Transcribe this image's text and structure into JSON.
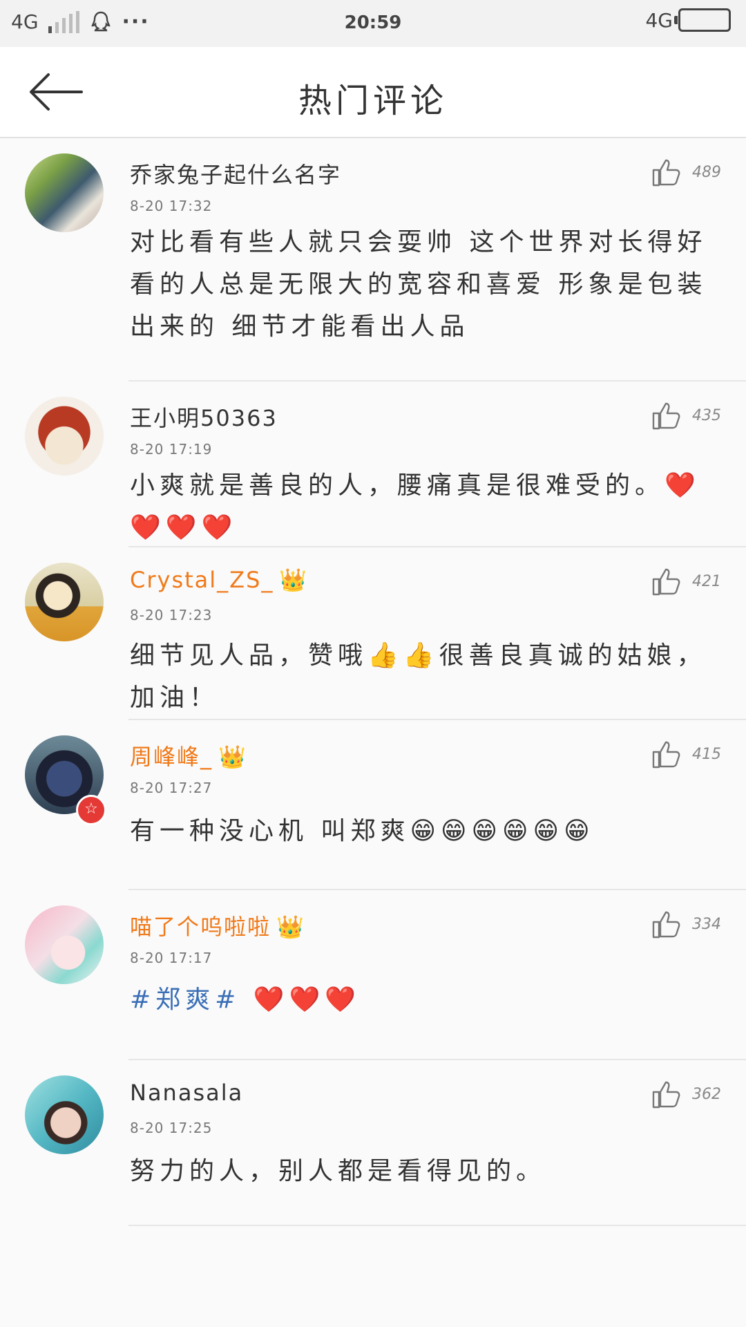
{
  "status_bar": {
    "network_left": "4G",
    "time": "20:59",
    "network_right": "4G"
  },
  "header": {
    "title": "热门评论"
  },
  "comments": [
    {
      "name": "乔家兔子起什么名字",
      "time": "8-20 17:32",
      "likes": "489",
      "text": "对比看有些人就只会耍帅  这个世界对长得好看的人总是无限大的宽容和喜爱  形象是包装出来的  细节才能看出人品"
    },
    {
      "name": "王小明50363",
      "time": "8-20 17:19",
      "likes": "435",
      "text": "小爽就是善良的人，腰痛真是很难受的。❤️❤️❤️❤️"
    },
    {
      "name": "Crystal_ZS_",
      "time": "8-20 17:23",
      "likes": "421",
      "text": "细节见人品，赞哦👍👍很善良真诚的姑娘，加油！"
    },
    {
      "name": "周峰峰_",
      "time": "8-20 17:27",
      "likes": "415",
      "text": "有一种没心机 叫郑爽😁😁😁😁😁😁"
    },
    {
      "name": "喵了个呜啦啦",
      "time": "8-20 17:17",
      "likes": "334",
      "topic": "#郑爽#",
      "text": " ❤️❤️❤️"
    },
    {
      "name": "Nanasala",
      "time": "8-20 17:25",
      "likes": "362",
      "text": "努力的人，别人都是看得见的。"
    }
  ],
  "icons": {
    "back": "arrow-left-icon",
    "like": "thumbs-up-icon",
    "vip": "crown-icon",
    "badge": "star-badge-icon"
  },
  "colors": {
    "vip_name": "#f07a1a",
    "topic": "#3b6fb6",
    "badge": "#e53935"
  }
}
